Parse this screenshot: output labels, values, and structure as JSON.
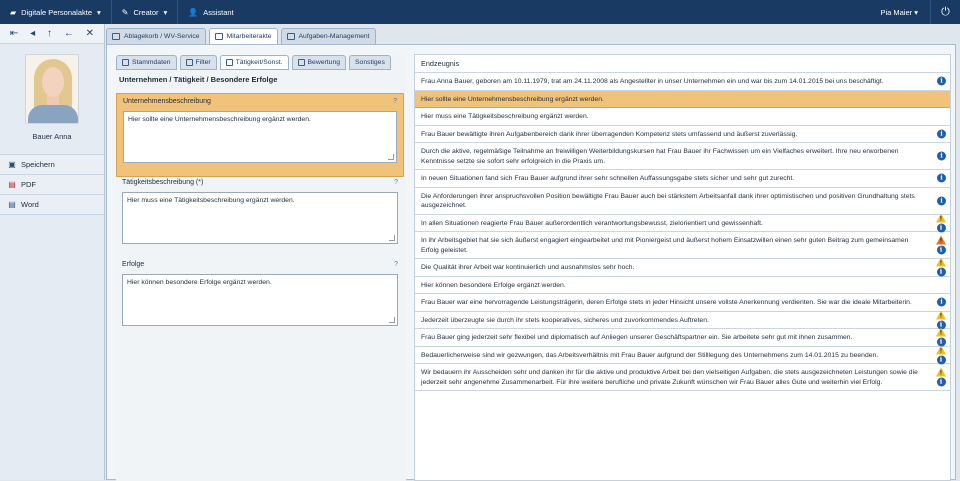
{
  "topbar": {
    "menus": [
      {
        "label": "Digitale Personalakte",
        "icon": "folder-icon"
      },
      {
        "label": "Creator",
        "icon": "creator-icon"
      },
      {
        "label": "Assistant",
        "icon": "user-icon"
      }
    ],
    "user": "Pia Maier",
    "power_icon": "power-icon"
  },
  "sidebar": {
    "nav_icons": [
      "first-page-icon",
      "previous-icon",
      "up-icon",
      "back-icon",
      "close-icon"
    ],
    "person_name": "Bauer Anna",
    "actions": [
      {
        "label": "Speichern",
        "icon": "save-icon"
      },
      {
        "label": "PDF",
        "icon": "pdf-icon"
      },
      {
        "label": "Word",
        "icon": "word-icon"
      }
    ]
  },
  "tabs": [
    {
      "label": "Ablagekorb / WV-Service",
      "active": false
    },
    {
      "label": "Mitarbeiterakte",
      "active": true
    },
    {
      "label": "Aufgaben-Management",
      "active": false
    }
  ],
  "form": {
    "subtabs": [
      {
        "label": "Stammdaten",
        "active": false
      },
      {
        "label": "Filter",
        "active": false
      },
      {
        "label": "Tätigkeit/Sonst.",
        "active": true
      },
      {
        "label": "Bewertung",
        "active": false
      },
      {
        "label": "Sonstiges",
        "active": false
      }
    ],
    "section_title": "Unternehmen / Tätigkeit / Besondere Erfolge",
    "groups": [
      {
        "label": "Unternehmensbeschreibung",
        "text": "Hier sollte eine Unternehmensbeschreibung ergänzt werden.",
        "help": "?"
      },
      {
        "label": "Tätigkeitsbeschreibung (*)",
        "text": "Hier muss eine Tätigkeitsbeschreibung ergänzt werden.",
        "help": "?"
      },
      {
        "label": "Erfolge",
        "text": "Hier können besondere Erfolge ergänzt werden.",
        "help": "?"
      }
    ]
  },
  "zeugnis": {
    "header": "Endzeugnis",
    "rows": [
      {
        "text": "Frau Anna Bauer, geboren am 10.11.1979, trat am 24.11.2008 als Angestellter in unser Unternehmen ein und war bis zum 14.01.2015 bei uns beschäftigt.",
        "status": [
          "info"
        ]
      },
      {
        "text": "Hier sollte eine Unternehmensbeschreibung ergänzt werden.",
        "status": [],
        "highlight": true
      },
      {
        "text": "Hier muss eine Tätigkeitsbeschreibung ergänzt werden.",
        "status": []
      },
      {
        "text": "Frau Bauer bewältigte ihren Aufgabenbereich dank ihrer überragenden Kompetenz stets umfassend und äußerst zuverlässig.",
        "status": [
          "info"
        ]
      },
      {
        "text": "Durch die aktive, regelmäßige Teilnahme an freiwilligen Weiterbildungskursen hat Frau Bauer ihr Fachwissen um ein Vielfaches erweitert. Ihre neu erworbenen Kenntnisse setzte sie sofort sehr erfolgreich in die Praxis um.",
        "status": [
          "info"
        ]
      },
      {
        "text": "In neuen Situationen fand sich Frau Bauer aufgrund ihrer sehr schnellen Auffassungsgabe stets sicher und sehr gut zurecht.",
        "status": [
          "info"
        ]
      },
      {
        "text": "Die Anforderungen ihrer anspruchsvollen Position bewältigte Frau Bauer auch bei stärkstem Arbeitsanfall dank ihrer optimistischen und positiven Grundhaltung stets ausgezeichnet.",
        "status": [
          "info"
        ]
      },
      {
        "text": "In allen Situationen reagierte Frau Bauer außerordentlich verantwortungsbewusst, zielorientiert und gewissenhaft.",
        "status": [
          "warning",
          "info"
        ]
      },
      {
        "text": "In ihr Arbeitsgebiet hat sie sich äußerst engagiert eingearbeitet und mit Pioniergeist und äußerst hohem Einsatzwillen einen sehr guten Beitrag zum gemeinsamen Erfolg geleistet.",
        "status": [
          "warning-orange",
          "info"
        ]
      },
      {
        "text": "Die Qualität ihrer Arbeit war kontinuierlich und ausnahmslos sehr hoch.",
        "status": [
          "warning",
          "info"
        ]
      },
      {
        "text": "Hier können besondere Erfolge ergänzt werden.",
        "status": []
      },
      {
        "text": "Frau Bauer war eine hervorragende Leistungsträgerin, deren Erfolge stets in jeder Hinsicht unsere vollste Anerkennung verdienten. Sie war die ideale Mitarbeiterin.",
        "status": [
          "info"
        ]
      },
      {
        "text": "Jederzeit überzeugte sie durch ihr stets kooperatives, sicheres und zuvorkommendes Auftreten.",
        "status": [
          "warning",
          "info"
        ]
      },
      {
        "text": "Frau Bauer ging jederzeit sehr flexibel und diplomatisch auf Anliegen unserer Geschäftspartner ein. Sie arbeitete sehr gut mit ihnen zusammen.",
        "status": [
          "warning",
          "info"
        ]
      },
      {
        "text": "Bedauerlicherweise sind wir gezwungen, das Arbeitsverhältnis mit Frau Bauer aufgrund der Stilllegung des Unternehmens zum 14.01.2015 zu beenden.",
        "status": [
          "warning",
          "info"
        ]
      },
      {
        "text": "Wir bedauern ihr Ausscheiden sehr und danken ihr für die aktive und produktive Arbeit bei den vielseitigen Aufgaben, die stets ausgezeichneten Leistungen sowie die jederzeit sehr angenehme Zusammenarbeit. Für ihre weitere berufliche und private Zukunft wünschen wir Frau Bauer alles Gute und weiterhin viel Erfolg.",
        "status": [
          "warning",
          "info"
        ]
      }
    ]
  },
  "colors": {
    "topbar": "#183a63",
    "highlight": "#f1c27a",
    "info": "#1d5fa8",
    "warning": "#f2c01c",
    "warning_orange": "#e8741c"
  }
}
